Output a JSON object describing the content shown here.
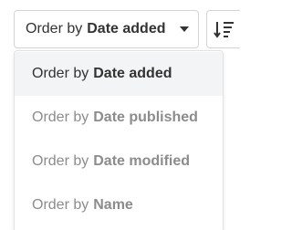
{
  "order_select": {
    "prefix": "Order by",
    "value": "Date added",
    "caret_icon": "caret-down-icon"
  },
  "sort_direction": {
    "icon": "sort-descending-icon"
  },
  "menu": {
    "items": [
      {
        "prefix": "Order by",
        "value": "Date added",
        "selected": true
      },
      {
        "prefix": "Order by",
        "value": "Date published",
        "selected": false
      },
      {
        "prefix": "Order by",
        "value": "Date modified",
        "selected": false
      },
      {
        "prefix": "Order by",
        "value": "Name",
        "selected": false
      }
    ]
  },
  "colors": {
    "text": "#333333",
    "muted_text": "#8c8c8c",
    "border": "#d4d4d4",
    "selected_bg": "#f3f4f5"
  }
}
